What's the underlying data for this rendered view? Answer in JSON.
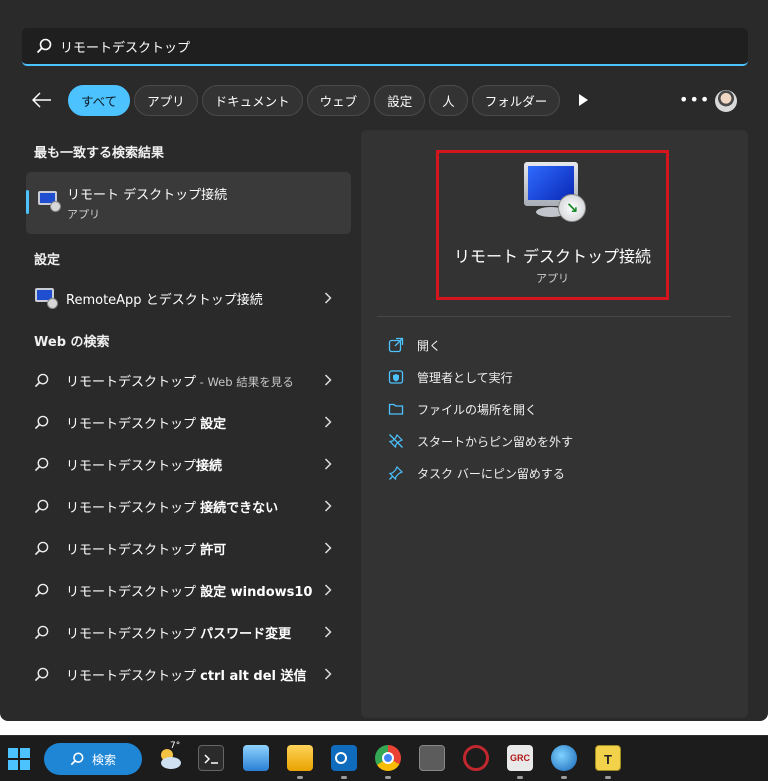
{
  "search": {
    "value": "リモートデスクトップ"
  },
  "filters": [
    "すべて",
    "アプリ",
    "ドキュメント",
    "ウェブ",
    "設定",
    "人",
    "フォルダー"
  ],
  "best_match": {
    "heading": "最も一致する検索結果",
    "title": "リモート デスクトップ接続",
    "subtitle": "アプリ"
  },
  "settings": {
    "heading": "設定",
    "item": "RemoteApp とデスクトップ接続"
  },
  "web": {
    "heading": "Web の検索",
    "items": [
      {
        "base": "リモートデスクトップ",
        "bold": "",
        "suffix": " - Web 結果を見る"
      },
      {
        "base": "リモートデスクトップ ",
        "bold": "設定",
        "suffix": ""
      },
      {
        "base": "リモートデスクトップ",
        "bold": "接続",
        "suffix": ""
      },
      {
        "base": "リモートデスクトップ ",
        "bold": "接続できない",
        "suffix": ""
      },
      {
        "base": "リモートデスクトップ ",
        "bold": "許可",
        "suffix": ""
      },
      {
        "base": "リモートデスクトップ ",
        "bold": "設定 windows10",
        "suffix": ""
      },
      {
        "base": "リモートデスクトップ ",
        "bold": "パスワード変更",
        "suffix": ""
      },
      {
        "base": "リモートデスクトップ ",
        "bold": "ctrl alt del 送信",
        "suffix": ""
      }
    ]
  },
  "preview": {
    "title": "リモート デスクトップ接続",
    "subtitle": "アプリ",
    "actions": [
      "開く",
      "管理者として実行",
      "ファイルの場所を開く",
      "スタートからピン留めを外す",
      "タスク バーにピン留めする"
    ]
  },
  "taskbar": {
    "search_label": "検索",
    "temperature": "7°"
  },
  "colors": {
    "accent": "#4cc2ff",
    "highlight": "#d5151d",
    "panel": "#2a2a2a"
  }
}
